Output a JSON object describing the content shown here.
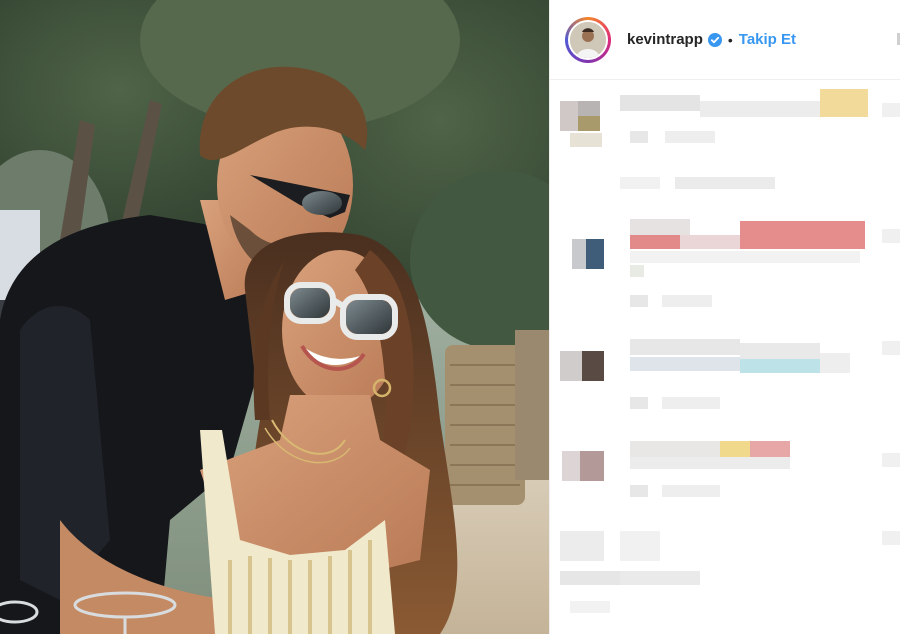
{
  "post": {
    "username": "kevintrapp",
    "verified": true,
    "separator": "•",
    "follow_label": "Takip Et"
  },
  "colors": {
    "follow": "#3897f0",
    "verified": "#3897f0",
    "border": "#efefef"
  },
  "icons": {
    "verified": "verified-badge-icon",
    "more": "more-options-icon"
  }
}
